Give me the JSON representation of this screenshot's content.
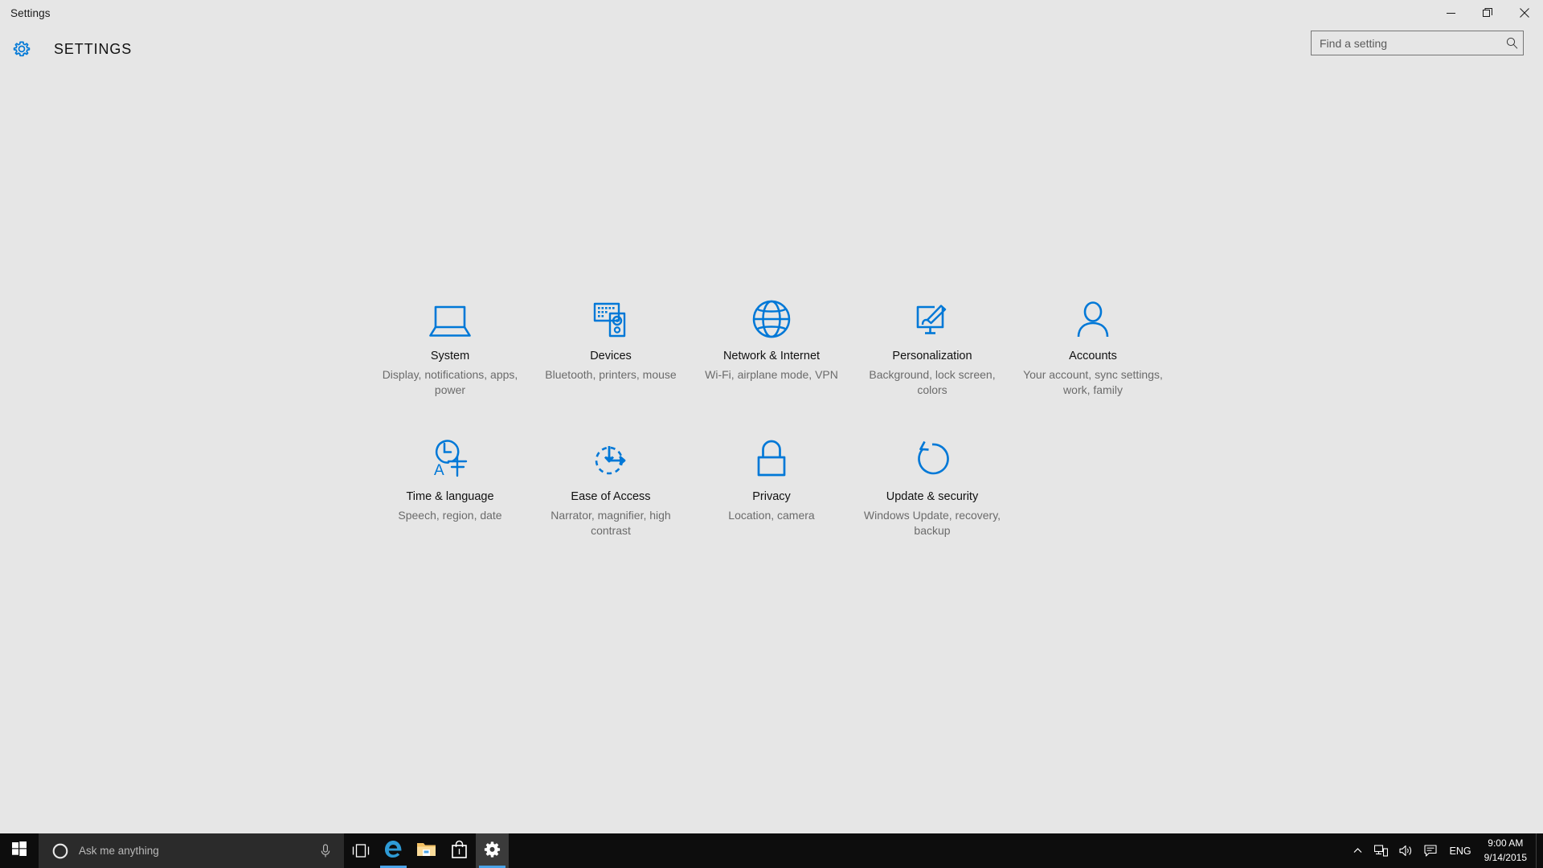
{
  "window": {
    "title": "Settings",
    "controls": [
      {
        "name": "minimize",
        "label": "Minimize"
      },
      {
        "name": "restore",
        "label": "Restore"
      },
      {
        "name": "close",
        "label": "Close"
      }
    ]
  },
  "header": {
    "title": "SETTINGS",
    "icon": "gear-icon"
  },
  "search": {
    "placeholder": "Find a setting",
    "value": "",
    "icon": "search-icon"
  },
  "colors": {
    "accent": "#0078D7",
    "background": "#E6E6E6",
    "taskbar": "#0D0D0D",
    "title_text": "#111111",
    "sub_text": "#6B6B6B"
  },
  "tiles": [
    {
      "icon": "laptop-icon",
      "title": "System",
      "subtitle": "Display, notifications, apps, power"
    },
    {
      "icon": "keyboard-mouse-icon",
      "title": "Devices",
      "subtitle": "Bluetooth, printers, mouse"
    },
    {
      "icon": "globe-icon",
      "title": "Network & Internet",
      "subtitle": "Wi-Fi, airplane mode, VPN"
    },
    {
      "icon": "paintbrush-monitor-icon",
      "title": "Personalization",
      "subtitle": "Background, lock screen, colors"
    },
    {
      "icon": "person-icon",
      "title": "Accounts",
      "subtitle": "Your account, sync settings, work, family"
    },
    {
      "icon": "clock-language-icon",
      "title": "Time & language",
      "subtitle": "Speech, region, date"
    },
    {
      "icon": "ease-of-access-icon",
      "title": "Ease of Access",
      "subtitle": "Narrator, magnifier, high contrast"
    },
    {
      "icon": "lock-icon",
      "title": "Privacy",
      "subtitle": "Location, camera"
    },
    {
      "icon": "refresh-icon",
      "title": "Update & security",
      "subtitle": "Windows Update, recovery, backup"
    }
  ],
  "taskbar": {
    "start": {
      "icon": "windows-logo-icon",
      "label": "Start"
    },
    "cortana": {
      "icon": "cortana-circle-icon",
      "placeholder": "Ask me anything",
      "mic_icon": "microphone-icon"
    },
    "buttons": [
      {
        "icon": "task-view-icon",
        "label": "Task View",
        "active": false,
        "running": false
      },
      {
        "icon": "edge-icon",
        "label": "Microsoft Edge",
        "active": false,
        "running": true
      },
      {
        "icon": "file-explorer-icon",
        "label": "File Explorer",
        "active": false,
        "running": false
      },
      {
        "icon": "store-icon",
        "label": "Store",
        "active": false,
        "running": false
      },
      {
        "icon": "settings-gear-icon",
        "label": "Settings",
        "active": true,
        "running": true
      }
    ],
    "tray": {
      "chevron": {
        "icon": "chevron-up-icon",
        "label": "Show hidden icons"
      },
      "items": [
        {
          "icon": "network-icon",
          "label": "Network"
        },
        {
          "icon": "volume-icon",
          "label": "Volume"
        },
        {
          "icon": "action-center-icon",
          "label": "Action Center"
        }
      ],
      "language": "ENG",
      "time": "9:00 AM",
      "date": "9/14/2015"
    }
  }
}
